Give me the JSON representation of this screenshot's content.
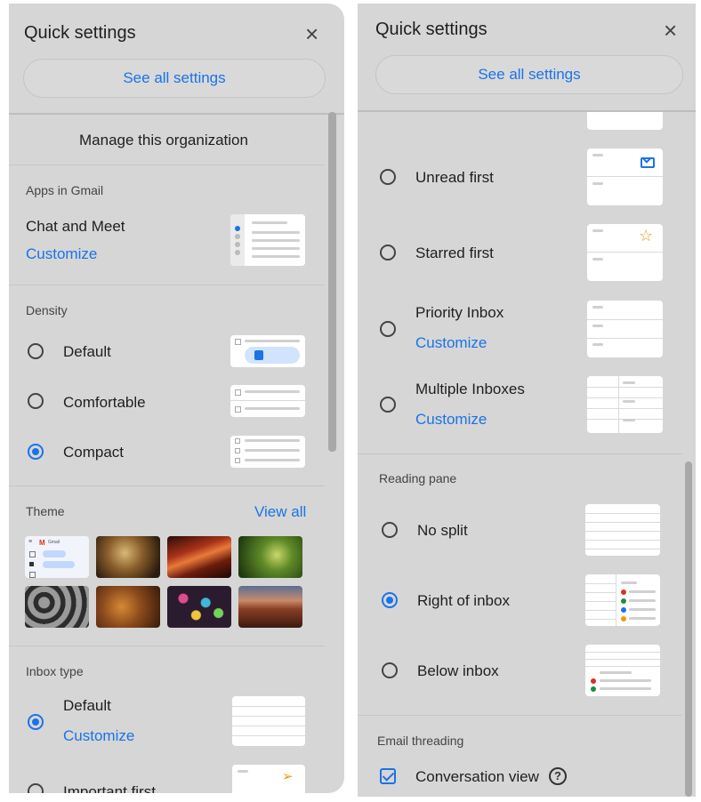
{
  "left": {
    "title": "Quick settings",
    "see_all": "See all settings",
    "manage_org": "Manage this organization",
    "apps": {
      "heading": "Apps in Gmail",
      "item": "Chat and Meet",
      "customize": "Customize"
    },
    "density": {
      "heading": "Density",
      "options": [
        {
          "label": "Default",
          "selected": false
        },
        {
          "label": "Comfortable",
          "selected": false
        },
        {
          "label": "Compact",
          "selected": true
        }
      ]
    },
    "theme": {
      "heading": "Theme",
      "view_all": "View all"
    },
    "inbox_type": {
      "heading": "Inbox type",
      "options": [
        {
          "label": "Default",
          "customize": "Customize",
          "selected": true
        },
        {
          "label": "Important first",
          "selected": false
        }
      ]
    }
  },
  "right": {
    "title": "Quick settings",
    "see_all": "See all settings",
    "inbox_options": [
      {
        "label": "Unread first",
        "selected": false
      },
      {
        "label": "Starred first",
        "selected": false
      },
      {
        "label": "Priority Inbox",
        "customize": "Customize",
        "selected": false
      },
      {
        "label": "Multiple Inboxes",
        "customize": "Customize",
        "selected": false
      }
    ],
    "reading_pane": {
      "heading": "Reading pane",
      "options": [
        {
          "label": "No split",
          "selected": false
        },
        {
          "label": "Right of inbox",
          "selected": true
        },
        {
          "label": "Below inbox",
          "selected": false
        }
      ]
    },
    "threading": {
      "heading": "Email threading",
      "conversation_view": "Conversation view",
      "checked": true,
      "help": "?"
    }
  },
  "theme_thumb": {
    "brand": "Gmail"
  },
  "colors": {
    "accent": "#1a73e8",
    "panel_bg": "#d6d6d6"
  },
  "icons": {
    "close": "×"
  }
}
